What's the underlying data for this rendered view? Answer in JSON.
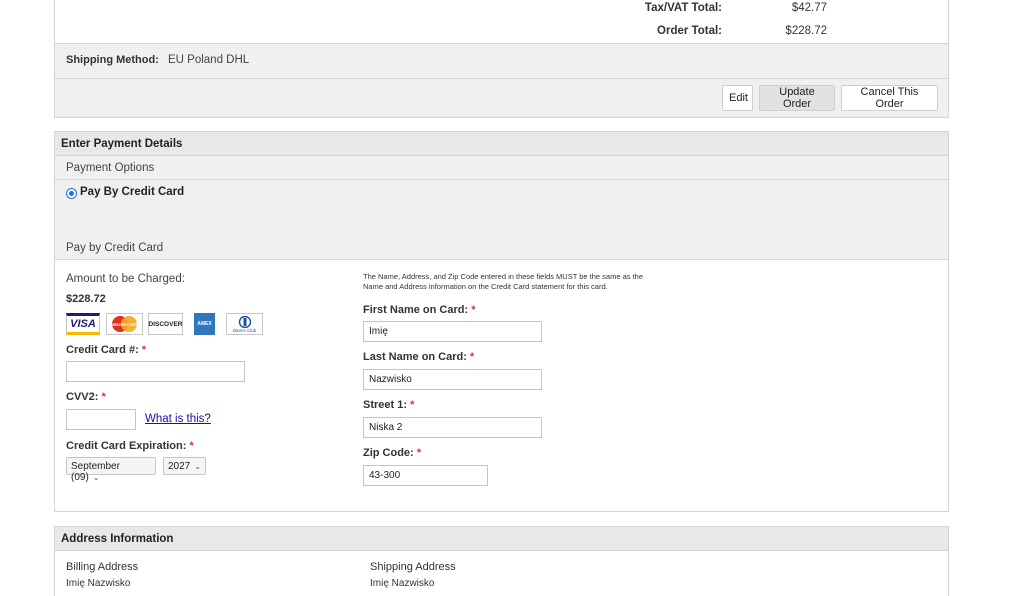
{
  "order_totals": {
    "tax_label": "Tax/VAT Total:",
    "tax_value": "$42.77",
    "order_label": "Order Total:",
    "order_value": "$228.72"
  },
  "shipping": {
    "label": "Shipping Method:",
    "value": "EU Poland DHL"
  },
  "order_actions": {
    "edit": "Edit",
    "update": "Update Order",
    "cancel": "Cancel This Order"
  },
  "payment": {
    "header": "Enter Payment Details",
    "options_header": "Payment Options",
    "option_label": "Pay By Credit Card",
    "section_title": "Pay by Credit Card",
    "amount_label": "Amount to be Charged:",
    "amount_value": "$228.72",
    "card_logos": [
      {
        "name": "visa",
        "text": "VISA",
        "color": "#1a1f71"
      },
      {
        "name": "mastercard",
        "text": "MasterCard",
        "color": "#eb6d1f"
      },
      {
        "name": "discover",
        "text": "DISCOVER",
        "color": "#f58220"
      },
      {
        "name": "amex",
        "text": "AMEX",
        "color": "#2e77bb"
      },
      {
        "name": "diners-club",
        "text": "Diners Club",
        "color": "#1b4f9c"
      }
    ],
    "cc_number_label": "Credit Card #:",
    "cc_number_value": "",
    "cvv_label": "CVV2:",
    "cvv_value": "",
    "cvv_help_link": "What is this?",
    "expiration_label": "Credit Card Expiration:",
    "exp_month": "September (09)",
    "exp_year": "2027",
    "required_mark": "*",
    "notice": "The Name, Address, and Zip Code entered in these fields MUST be the same as the Name and Address information on the Credit Card statement for this card.",
    "first_name_label": "First Name on Card:",
    "first_name_value": "Imię",
    "last_name_label": "Last Name on Card:",
    "last_name_value": "Nazwisko",
    "street_label": "Street 1:",
    "street_value": "Niska 2",
    "zip_label": "Zip Code:",
    "zip_value": "43-300"
  },
  "address": {
    "header": "Address Information",
    "billing_title": "Billing Address",
    "billing_name": "Imię Nazwisko",
    "shipping_title": "Shipping Address",
    "shipping_name": "Imię Nazwisko"
  },
  "colors": {
    "accent_blue": "#1a73e8",
    "link_blue": "#1a0dab",
    "required_red": "#dd3333"
  }
}
